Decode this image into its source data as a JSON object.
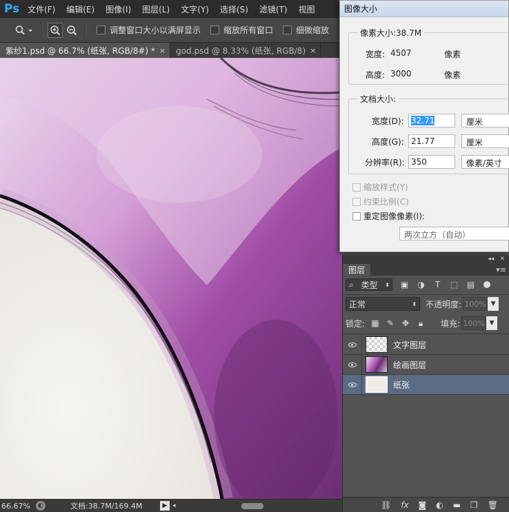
{
  "app": {
    "logo": "Ps"
  },
  "menu": [
    "文件(F)",
    "编辑(E)",
    "图像(I)",
    "图层(L)",
    "文字(Y)",
    "选择(S)",
    "滤镜(T)",
    "视图"
  ],
  "options": {
    "zoom_tool_icon": "zoom-icon",
    "fit_window": "调整窗口大小以满屏显示",
    "zoom_all": "缩放所有窗口",
    "scrubby_zoom": "细微缩放"
  },
  "tabs": [
    {
      "label": "紫纱1.psd @ 66.7% (纸张, RGB/8#) *",
      "close": "×",
      "active": true
    },
    {
      "label": "god.psd @ 8.33% (纸张, RGB/8)",
      "close": "×",
      "active": false
    }
  ],
  "status": {
    "zoom": "66.67%",
    "doc_info": "文档:38.7M/169.4M"
  },
  "image_size_dialog": {
    "title": "图像大小",
    "pixel_dimensions": {
      "title": "像素大小:38.7M",
      "width_label": "宽度:",
      "width_value": "4507",
      "width_unit": "像素",
      "height_label": "高度:",
      "height_value": "3000",
      "height_unit": "像素"
    },
    "document_size": {
      "title": "文档大小:",
      "width_label": "宽度(D):",
      "width_value": "32.71",
      "width_unit": "厘米",
      "height_label": "高度(G):",
      "height_value": "21.77",
      "height_unit": "厘米",
      "resolution_label": "分辨率(R):",
      "resolution_value": "350",
      "resolution_unit": "像素/英寸"
    },
    "scale_styles": "缩放样式(Y)",
    "constrain_proportions": "约束比例(C)",
    "resample": "重定图像像素(I):",
    "resample_method": "两次立方（自动）"
  },
  "layers_panel": {
    "tab": "图层",
    "filter_kind": "类型",
    "blend_mode": "正常",
    "opacity_label": "不透明度:",
    "opacity_value": "100%",
    "lock_label": "锁定:",
    "fill_label": "填充:",
    "fill_value": "100%",
    "layers": [
      {
        "name": "文字图层",
        "visible": true,
        "selected": false
      },
      {
        "name": "绘画图层",
        "visible": true,
        "selected": false
      },
      {
        "name": "纸张",
        "visible": true,
        "selected": true
      }
    ]
  },
  "colors": {
    "accent": "#31a8ff",
    "selection": "#3399ff",
    "layer_selected": "#5b6b84"
  }
}
